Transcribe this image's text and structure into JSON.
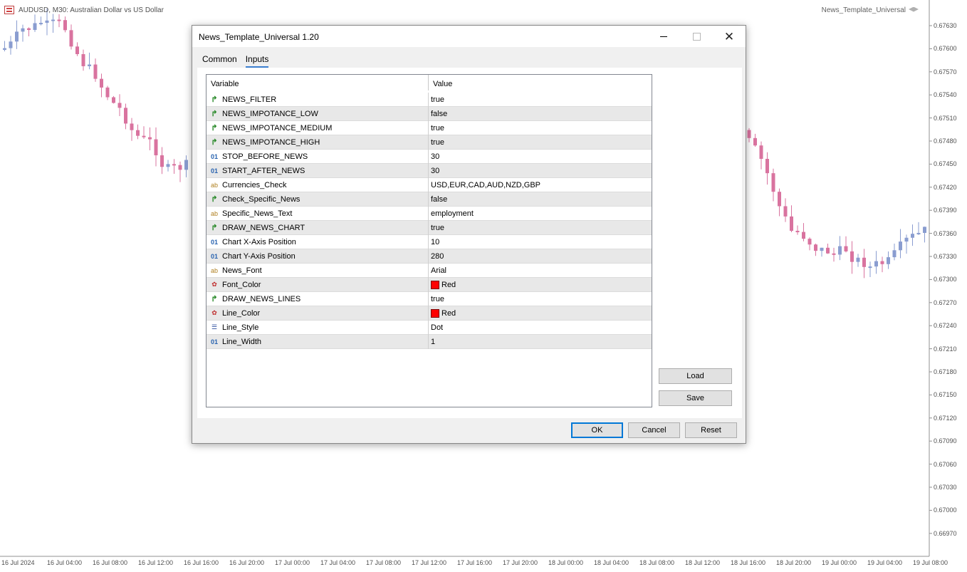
{
  "chart": {
    "symbol_title": "AUDUSD, M30:  Australian Dollar vs US Dollar",
    "ea_name": "News_Template_Universal",
    "price_labels": [
      "0.67630",
      "0.67600",
      "0.67570",
      "0.67540",
      "0.67510",
      "0.67480",
      "0.67450",
      "0.67420",
      "0.67390",
      "0.67360",
      "0.67330",
      "0.67300",
      "0.67270",
      "0.67240",
      "0.67210",
      "0.67180",
      "0.67150",
      "0.67120",
      "0.67090",
      "0.67060",
      "0.67030",
      "0.67000",
      "0.66970"
    ],
    "time_labels": [
      "16 Jul 2024",
      "16 Jul 04:00",
      "16 Jul 08:00",
      "16 Jul 12:00",
      "16 Jul 16:00",
      "16 Jul 20:00",
      "17 Jul 00:00",
      "17 Jul 04:00",
      "17 Jul 08:00",
      "17 Jul 12:00",
      "17 Jul 16:00",
      "17 Jul 20:00",
      "18 Jul 00:00",
      "18 Jul 04:00",
      "18 Jul 08:00",
      "18 Jul 12:00",
      "18 Jul 16:00",
      "18 Jul 20:00",
      "19 Jul 00:00",
      "19 Jul 04:00",
      "19 Jul 08:00"
    ],
    "colors": {
      "bull": "#8a9dd0",
      "bear": "#d9739f",
      "axis": "#909090"
    }
  },
  "dialog": {
    "title": "News_Template_Universal 1.20",
    "tabs": [
      {
        "label": "Common"
      },
      {
        "label": "Inputs"
      }
    ],
    "columns": {
      "variable": "Variable",
      "value": "Value"
    },
    "rows": [
      {
        "type": "bool-icon",
        "name": "NEWS_FILTER",
        "value": "true"
      },
      {
        "type": "bool-icon",
        "name": "NEWS_IMPOTANCE_LOW",
        "value": "false"
      },
      {
        "type": "bool-icon",
        "name": "NEWS_IMPOTANCE_MEDIUM",
        "value": "true"
      },
      {
        "type": "bool-icon",
        "name": "NEWS_IMPOTANCE_HIGH",
        "value": "true"
      },
      {
        "type": "int-icon",
        "name": "STOP_BEFORE_NEWS",
        "value": "30"
      },
      {
        "type": "int-icon",
        "name": "START_AFTER_NEWS",
        "value": "30"
      },
      {
        "type": "string-icon",
        "name": "Currencies_Check",
        "value": "USD,EUR,CAD,AUD,NZD,GBP"
      },
      {
        "type": "bool-icon",
        "name": "Check_Specific_News",
        "value": "false"
      },
      {
        "type": "string-icon",
        "name": "Specific_News_Text",
        "value": "employment"
      },
      {
        "type": "bool-icon",
        "name": "DRAW_NEWS_CHART",
        "value": "true"
      },
      {
        "type": "int-icon",
        "name": "Chart X-Axis Position",
        "value": "10"
      },
      {
        "type": "int-icon",
        "name": "Chart Y-Axis Position",
        "value": "280"
      },
      {
        "type": "string-icon",
        "name": "News_Font",
        "value": "Arial"
      },
      {
        "type": "color-icon",
        "name": "Font_Color",
        "value": "Red",
        "swatch": "#ff0000"
      },
      {
        "type": "bool-icon",
        "name": "DRAW_NEWS_LINES",
        "value": "true"
      },
      {
        "type": "color-icon",
        "name": "Line_Color",
        "value": "Red",
        "swatch": "#ff0000"
      },
      {
        "type": "enum-icon",
        "name": "Line_Style",
        "value": "Dot"
      },
      {
        "type": "int-icon",
        "name": "Line_Width",
        "value": "1"
      }
    ],
    "icon_glyphs": {
      "bool-icon": "↱",
      "int-icon": "01",
      "string-icon": "ab",
      "color-icon": "✿",
      "enum-icon": "☰"
    },
    "buttons": {
      "load": "Load",
      "save": "Save",
      "ok": "OK",
      "cancel": "Cancel",
      "reset": "Reset"
    },
    "win_controls": {
      "minimize": "—",
      "maximize": "□",
      "close": "✕"
    }
  }
}
